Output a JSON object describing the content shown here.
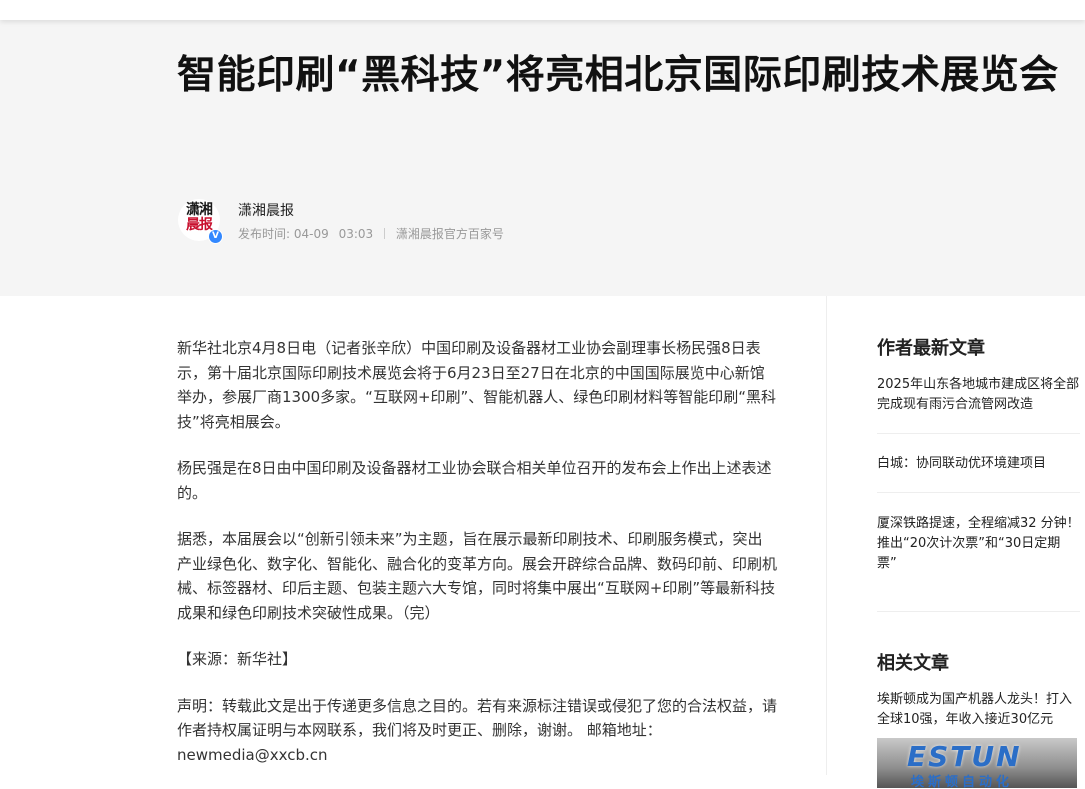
{
  "article": {
    "title": "智能印刷“黑科技”将亮相北京国际印刷技术展览会",
    "author": {
      "name": "潇湘晨报",
      "avatar_logo_line1": "潇湘",
      "avatar_logo_line2": "晨报",
      "verified_mark": "V"
    },
    "publish_label": "发布时间:",
    "publish_date": "04-09",
    "publish_time": "03:03",
    "source_account": "潇湘晨报官方百家号",
    "paragraphs": [
      "新华社北京4月8日电（记者张辛欣）中国印刷及设备器材工业协会副理事长杨民强8日表示，第十届北京国际印刷技术展览会将于6月23日至27日在北京的中国国际展览中心新馆举办，参展厂商1300多家。“互联网+印刷”、智能机器人、绿色印刷材料等智能印刷“黑科技”将亮相展会。",
      "杨民强是在8日由中国印刷及设备器材工业协会联合相关单位召开的发布会上作出上述表述的。",
      "据悉，本届展会以“创新引领未来”为主题，旨在展示最新印刷技术、印刷服务模式，突出产业绿色化、数字化、智能化、融合化的变革方向。展会开辟综合品牌、数码印前、印刷机械、标签器材、印后主题、包装主题六大专馆，同时将集中展出“互联网+印刷”等最新科技成果和绿色印刷技术突破性成果。（完）",
      "【来源：新华社】",
      "声明：转载此文是出于传递更多信息之目的。若有来源标注错误或侵犯了您的合法权益，请作者持权属证明与本网联系，我们将及时更正、删除，谢谢。 邮箱地址：newmedia@xxcb.cn"
    ]
  },
  "sidebar": {
    "latest_heading": "作者最新文章",
    "latest_articles": [
      "2025年山东各地城市建成区将全部完成现有雨污合流管网改造",
      "白城：协同联动优环境建项目",
      "厦深铁路提速，全程缩减32 分钟！推出“20次计次票”和“30日定期票”"
    ],
    "related_heading": "相关文章",
    "related_articles": [
      "埃斯顿成为国产机器人龙头！打入全球10强，年收入接近30亿元"
    ],
    "thumbnail": {
      "brand": "ESTUN",
      "brand_sub": "埃斯顿自动化"
    }
  }
}
